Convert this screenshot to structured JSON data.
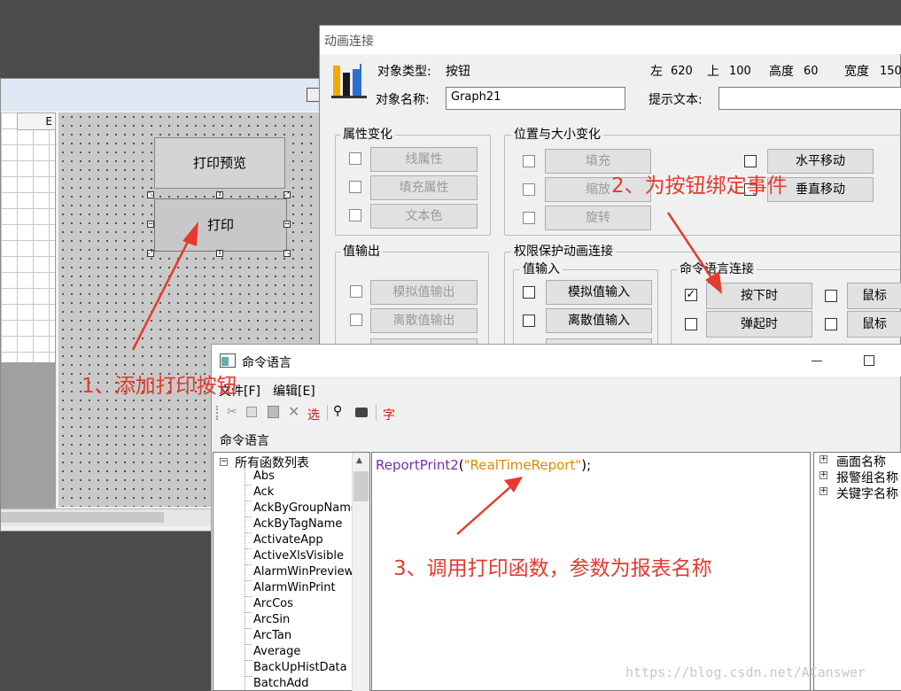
{
  "editor": {
    "col_header": "E",
    "button_preview": "打印预览",
    "button_print": "打印",
    "annotation": "1、添加打印按钮"
  },
  "anim": {
    "title": "动画连接",
    "obj_type_label": "对象类型:",
    "obj_type_value": "按钮",
    "left_label": "左",
    "left_value": "620",
    "top_label": "上",
    "top_value": "100",
    "height_label": "高度",
    "height_value": "60",
    "width_label": "宽度",
    "width_value": "150",
    "obj_name_label": "对象名称:",
    "obj_name_value": "Graph21",
    "tip_label": "提示文本:",
    "tip_value": "",
    "attr_group": "属性变化",
    "attr_items": [
      "线属性",
      "填充属性",
      "文本色"
    ],
    "pos_group": "位置与大小变化",
    "pos_items": [
      "填充",
      "缩放",
      "旋转"
    ],
    "hmove": "水平移动",
    "vmove": "垂直移动",
    "annotation": "2、为按钮绑定事件",
    "out_group": "值输出",
    "out_items": [
      "模拟值输出",
      "离散值输出"
    ],
    "perm_group": "权限保护动画连接",
    "in_group": "值输入",
    "in_items": [
      "模拟值输入",
      "离散值输入"
    ],
    "cmd_group": "命令语言连接",
    "press": "按下时",
    "release": "弹起时",
    "mouse1": "鼠标",
    "mouse2": "鼠标"
  },
  "cmd": {
    "title": "命令语言",
    "menu_file": "文件[F]",
    "menu_edit": "编辑[E]",
    "tb_select": "选",
    "tb_font": "字",
    "section_label": "命令语言",
    "tree_root": "所有函数列表",
    "functions": [
      "Abs",
      "Ack",
      "AckByGroupName",
      "AckByTagName",
      "ActivateApp",
      "ActiveXlsVisible",
      "AlarmWinPreview",
      "AlarmWinPrint",
      "ArcCos",
      "ArcSin",
      "ArcTan",
      "Average",
      "BackUpHistData",
      "BatchAdd"
    ],
    "code_func": "ReportPrint2",
    "code_open": "(",
    "code_arg": "\"RealTimeReport\"",
    "code_close": ");",
    "annotation": "3、调用打印函数，参数为报表名称",
    "right_tree": [
      "画面名称",
      "报警组名称",
      "关键字名称"
    ]
  },
  "watermark": "https://blog.csdn.net/ACanswer",
  "colors": {
    "annotation": "#e53a2f",
    "code_func": "#7a2ab0",
    "code_string": "#e08a00"
  }
}
